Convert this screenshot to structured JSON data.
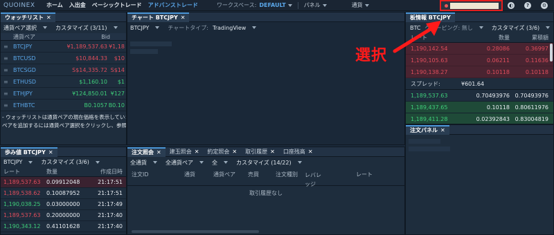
{
  "topbar": {
    "logo": "QUOINEX",
    "nav": [
      "ホーム",
      "入出金",
      "ベーシックトレード",
      "アドバンストレード"
    ],
    "workspace_label": "ワークスペース:",
    "workspace_value": "DEFAULT",
    "panel_label": "パネル",
    "currency_label": "通貨"
  },
  "annotation": {
    "label": "選択"
  },
  "watchlist": {
    "tab": "ウォッチリスト",
    "toolbar": [
      "通貨ペア選択",
      "カスタマイズ (3/11)"
    ],
    "headers": [
      "通貨ペア",
      "Bid"
    ],
    "rows": [
      {
        "pair": "BTCJPY",
        "bid": "¥1,189,537.63",
        "bid2": "¥1,18",
        "color": "ask"
      },
      {
        "pair": "BTCUSD",
        "bid": "$10,844.33",
        "bid2": "$10",
        "color": "ask"
      },
      {
        "pair": "BTCSGD",
        "bid": "S$14,335.72",
        "bid2": "S$14",
        "color": "ask"
      },
      {
        "pair": "ETHUSD",
        "bid": "$1,160.10",
        "bid2": "$1",
        "color": "bid"
      },
      {
        "pair": "ETHJPY",
        "bid": "¥124,850.01",
        "bid2": "¥127",
        "color": "bid"
      },
      {
        "pair": "ETHBTC",
        "bid": "B0.1057",
        "bid2": "B0.10",
        "color": "bid"
      }
    ],
    "note1": "- ウォッチリストは通貨ペアの現在価格を表示しています",
    "note2": "ペアを追加するには通貨ペア選択をクリックし、参照してください"
  },
  "chart": {
    "tab": "チャート BTCJPY",
    "pair": "BTCJPY",
    "type_label": "チャートタイプ:",
    "type_value": "TradingView"
  },
  "orderbook": {
    "tab": "板情報 BTCJPY",
    "pair": "BTC",
    "grouping_label": "グルーピング: 無し",
    "customize": "カスタマイズ (3/6)",
    "headers": [
      "レート",
      "数量",
      "累積額"
    ],
    "asks": [
      {
        "rate": "1,190,142.54",
        "qty": "0.28086",
        "cum": "0.36997"
      },
      {
        "rate": "1,190,105.63",
        "qty": "0.06211",
        "cum": "0.11636"
      },
      {
        "rate": "1,190,138.27",
        "qty": "0.10118",
        "cum": "0.10118"
      }
    ],
    "spread_label": "スプレッド:",
    "spread_value": "¥601.64",
    "bids": [
      {
        "rate": "1,189,537.63",
        "qty": "0.70493976",
        "cum": "0.70493976"
      },
      {
        "rate": "1,189,437.65",
        "qty": "0.10118",
        "cum": "0.80611976"
      },
      {
        "rate": "1,189,411.28",
        "qty": "0.02392843",
        "cum": "0.83004819"
      }
    ]
  },
  "orderpanel": {
    "tab": "注文パネル"
  },
  "trades": {
    "tab": "歩み値 BTCJPY",
    "toolbar": [
      "BTCJPY",
      "カスタマイズ (3/6)"
    ],
    "headers": [
      "レート",
      "数量",
      "作成日時"
    ],
    "rows": [
      {
        "rate": "1,189,537.63",
        "qty": "0.09912048",
        "time": "21:17:51",
        "color": "ask"
      },
      {
        "rate": "1,189,538.62",
        "qty": "0.10087952",
        "time": "21:17:51",
        "color": "ask"
      },
      {
        "rate": "1,190,038.25",
        "qty": "0.03000000",
        "time": "21:17:49",
        "color": "bid"
      },
      {
        "rate": "1,189,537.63",
        "qty": "0.20000000",
        "time": "21:17:40",
        "color": "ask"
      },
      {
        "rate": "1,190,343.12",
        "qty": "0.41101628",
        "time": "21:17:40",
        "color": "bid"
      }
    ]
  },
  "orders": {
    "tabs": [
      "注文照会",
      "建玉照会",
      "約定照会",
      "取引履歴",
      "口座残高"
    ],
    "toolbar": [
      "全通貨",
      "全通貨ペア",
      "全",
      "カスタマイズ (14/22)"
    ],
    "headers": [
      "注文ID",
      "通貨",
      "通貨ペア",
      "売買",
      "注文種別",
      "レバレッジ",
      "レート"
    ],
    "empty": "取引履歴なし"
  }
}
